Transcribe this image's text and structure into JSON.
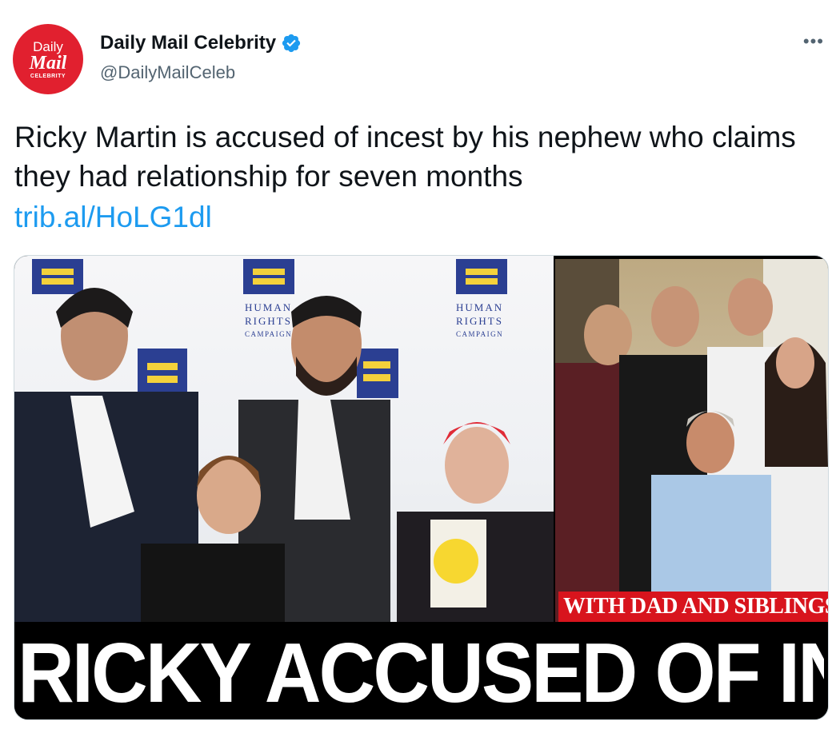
{
  "account": {
    "avatar_line1": "Daily",
    "avatar_line2": "Mail",
    "avatar_line3": "CELEBRITY",
    "display_name": "Daily Mail Celebrity",
    "handle": "@DailyMailCeleb",
    "verified": true
  },
  "more_label": "•••",
  "tweet": {
    "text": "Ricky Martin is accused of incest by his nephew who claims they had relationship for seven months",
    "link": "trib.al/HoLG1dl"
  },
  "media": {
    "backdrop_text": [
      "HUMAN",
      "RIGHTS",
      "CAMPAIGN"
    ],
    "caption": "WITH DAD AND SIBLINGS",
    "headline": "RICKY ACCUSED OF INCEST"
  },
  "icons": {
    "verified": "verified-badge-icon",
    "more": "more-options-icon"
  },
  "colors": {
    "brand_red": "#e1202f",
    "link_blue": "#1d9bf0",
    "verified_blue": "#1d9bf0",
    "secondary_text": "#536471",
    "caption_red": "#d8141d",
    "hrc_blue": "#2b3f92",
    "hrc_yellow": "#f4d13b"
  }
}
